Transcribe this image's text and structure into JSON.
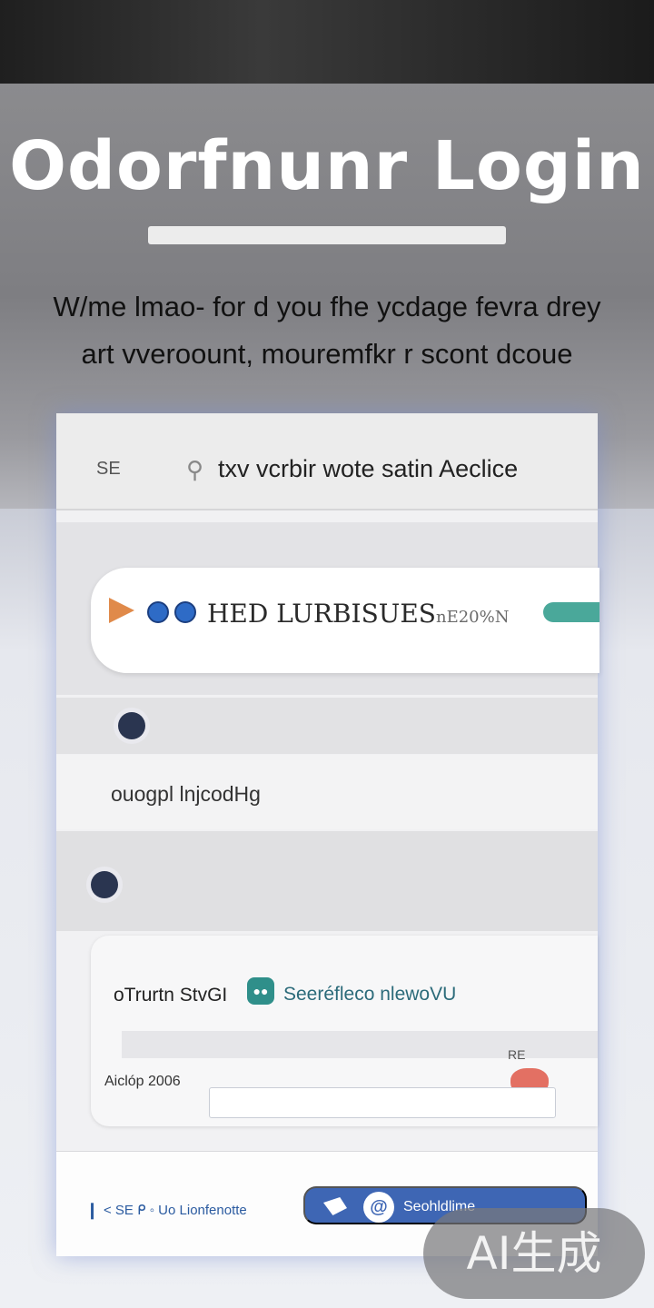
{
  "hero": {
    "title": "Odorfnunr Login",
    "subtitle_line1": "W/me lmao- for d you  fhe ycdage fevra drey",
    "subtitle_line2": "art vveroount,  mouremfkr r scont  dcoue"
  },
  "card": {
    "header": {
      "left_label": "SE",
      "icon": "search-icon",
      "text": "txv  vcrbir wote satin Aeclice"
    },
    "featured": {
      "text": "HED LURBISUES",
      "suffix": "nE20%N"
    },
    "row_value": "ouogpl lnjcodHg",
    "inner": {
      "label": "oTrurtn StvGI",
      "chip_icon": "chat-icon",
      "chip_text": "Seeréfleco nlewoVU",
      "marker": "RE",
      "input_label": "Aiclóp 2006",
      "input_value": ""
    },
    "footer": {
      "back_icon": "chevron-left-icon",
      "text": "< SE ᑭ ◦ Uo Lionfenotte",
      "button_label": "Seohldlime",
      "button_icon": "at-icon"
    }
  },
  "watermark": "AI生成",
  "colors": {
    "accent": "#3e66b4",
    "teal": "#2f8f8a",
    "heart": "#e37063"
  }
}
